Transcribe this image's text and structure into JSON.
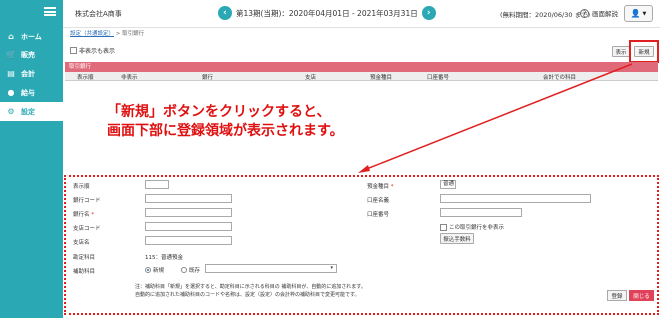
{
  "sidebar": {
    "items": [
      {
        "label": "ホーム",
        "icon": "home-icon"
      },
      {
        "label": "販売",
        "icon": "cart-icon"
      },
      {
        "label": "会計",
        "icon": "ledger-icon"
      },
      {
        "label": "給与",
        "icon": "money-bag-icon"
      },
      {
        "label": "設定",
        "icon": "gear-icon"
      }
    ]
  },
  "header": {
    "company": "株式会社A商事",
    "period": "第13期(当期)：2020年04月01日 - 2021年03月31日",
    "free_until": "(無料期間：2020/06/30 まで)",
    "help": "画面解説"
  },
  "breadcrumb": {
    "parent": "設定（共通設定）",
    "sep": ">",
    "current": "取引銀行"
  },
  "toolbar": {
    "hidden_label": "非表示も表示",
    "display_btn": "表示",
    "new_btn": "新規"
  },
  "table": {
    "title": "取引銀行",
    "columns": [
      "表示順",
      "非表示",
      "銀行",
      "支店",
      "預金種目",
      "口座番号",
      "会計での科目"
    ]
  },
  "annotation": {
    "line1": "「新規」ボタンをクリックすると、",
    "line2": "画面下部に登録領域が表示されます。"
  },
  "form": {
    "labels": {
      "order": "表示順",
      "bank_code": "銀行コード",
      "bank_name": "銀行名",
      "branch_code": "支店コード",
      "branch_name": "支店名",
      "account_subject": "勘定科目",
      "sub_subject": "補助科目",
      "deposit_type": "預金種目",
      "account_name": "口座名義",
      "account_number": "口座番号"
    },
    "required_mark": "*",
    "account_subject_value": "115：普通預金",
    "deposit_type_value": "普通",
    "radio_new": "新規",
    "radio_existing": "既存",
    "hide_checkbox": "この取引銀行を非表示",
    "transfer_fee_btn": "振込手数料",
    "note_line1": "注：補助科目「新規」を選択すると、勘定科目に示される科目の 補助科目が、自動的に追加されます。",
    "note_line2": "自動的に追加された補助科目のコードや名称は、設定（設定）の会計枠の補助科目で変更可能です。",
    "register_btn": "登録",
    "close_btn": "閉じる"
  },
  "colors": {
    "sidebar": "#2aa9b5",
    "table_title": "#e06a7a",
    "annotation": "#e01010",
    "close_btn": "#e0425a"
  }
}
